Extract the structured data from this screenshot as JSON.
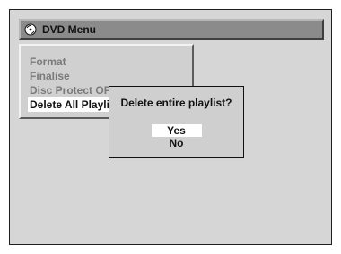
{
  "window": {
    "title": "DVD Menu",
    "icon": "disc-icon"
  },
  "menu": {
    "items": [
      {
        "label": "Format",
        "state": "disabled"
      },
      {
        "label": "Finalise",
        "state": "disabled"
      },
      {
        "label": "Disc Protect OFF",
        "state": "disabled"
      },
      {
        "label": "Delete All Playlist",
        "state": "selected"
      }
    ]
  },
  "dialog": {
    "question": "Delete entire playlist?",
    "options": [
      {
        "label": "Yes",
        "state": "selected"
      },
      {
        "label": "No",
        "state": "normal"
      }
    ]
  },
  "colors": {
    "screen_bg": "#d6d6d6",
    "title_bar_bg": "#8b8b8b",
    "menu_bg": "#d0d0d0",
    "highlight_bg": "#ffffff",
    "disabled_text": "#7a7a7a",
    "text": "#111111"
  }
}
